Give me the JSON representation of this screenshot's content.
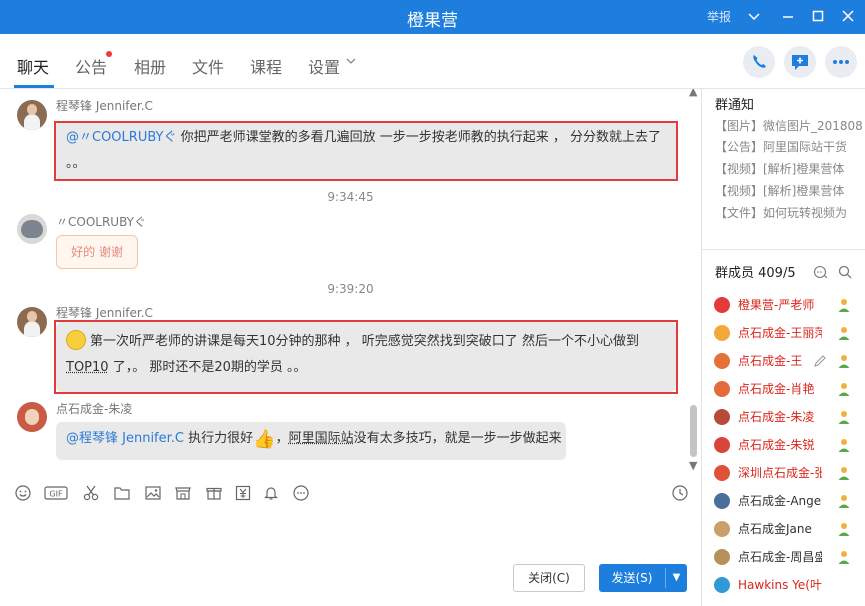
{
  "window": {
    "title": "橙果营",
    "report_label": "举报"
  },
  "tabs": [
    {
      "label": "聊天",
      "active": true
    },
    {
      "label": "公告",
      "has_dot": true
    },
    {
      "label": "相册"
    },
    {
      "label": "文件"
    },
    {
      "label": "课程"
    },
    {
      "label": "设置"
    }
  ],
  "messages": {
    "m1": {
      "sender": "程琴锋 Jennifer.C",
      "mention": "@〃COOLRUBYぐ",
      "line1": " 你把严老师课堂教的多看几遍回放 一步一步按老师教的执行起来 ， 分分数就上去了",
      "line2": "。。"
    },
    "time1": "9:34:45",
    "m2": {
      "sender": "〃COOLRUBYぐ",
      "sticker_text": "好的 谢谢"
    },
    "time2": "9:39:20",
    "m3": {
      "sender": "程琴锋 Jennifer.C",
      "line1": "第一次听严老师的讲课是每天10分钟的那种 ， 听完感觉突然找到突破口了 然后一个不小心做到",
      "top10": "TOP10",
      "line2": " 了，。 那时还不是20期的学员 。。"
    },
    "m4": {
      "sender": "点石成金-朱凌",
      "mention": "@程琴锋 Jennifer.C",
      "text1": " 执行力很好",
      "text2": "，",
      "link": "阿里国际站",
      "text3": "没有太多技巧，就是一步一步做起来"
    }
  },
  "composer": {
    "close_label": "关闭(C)",
    "send_label": "发送(S)"
  },
  "notice": {
    "title": "群通知",
    "items": [
      "【图片】微信图片_201808",
      "【公告】阿里国际站干货",
      "【视频】[解析]橙果营体",
      "【视频】[解析]橙果营体",
      "【文件】如何玩转视频为"
    ]
  },
  "members": {
    "title": "群成员 409/5",
    "list": [
      {
        "name": "橙果营-严老师",
        "color": "#d9261c"
      },
      {
        "name": "点石成金-王丽萍",
        "color": "#d9261c"
      },
      {
        "name": "点石成金-王",
        "color": "#d9261c"
      },
      {
        "name": "点石成金-肖艳",
        "color": "#d9261c"
      },
      {
        "name": "点石成金-朱凌",
        "color": "#d9261c"
      },
      {
        "name": "点石成金-朱锐",
        "color": "#d9261c"
      },
      {
        "name": "深圳点石成金-张",
        "color": "#d9261c"
      },
      {
        "name": "点石成金-Angel",
        "color": "#333333"
      },
      {
        "name": "点石成金Jane",
        "color": "#333333"
      },
      {
        "name": "点石成金-周昌盛",
        "color": "#333333"
      },
      {
        "name": "Hawkins Ye(叶辉)",
        "color": "#d9261c"
      }
    ]
  },
  "colors": {
    "accent": "#1d7ede",
    "highlight_border": "#e23b3b",
    "admin_name": "#d9261c"
  }
}
